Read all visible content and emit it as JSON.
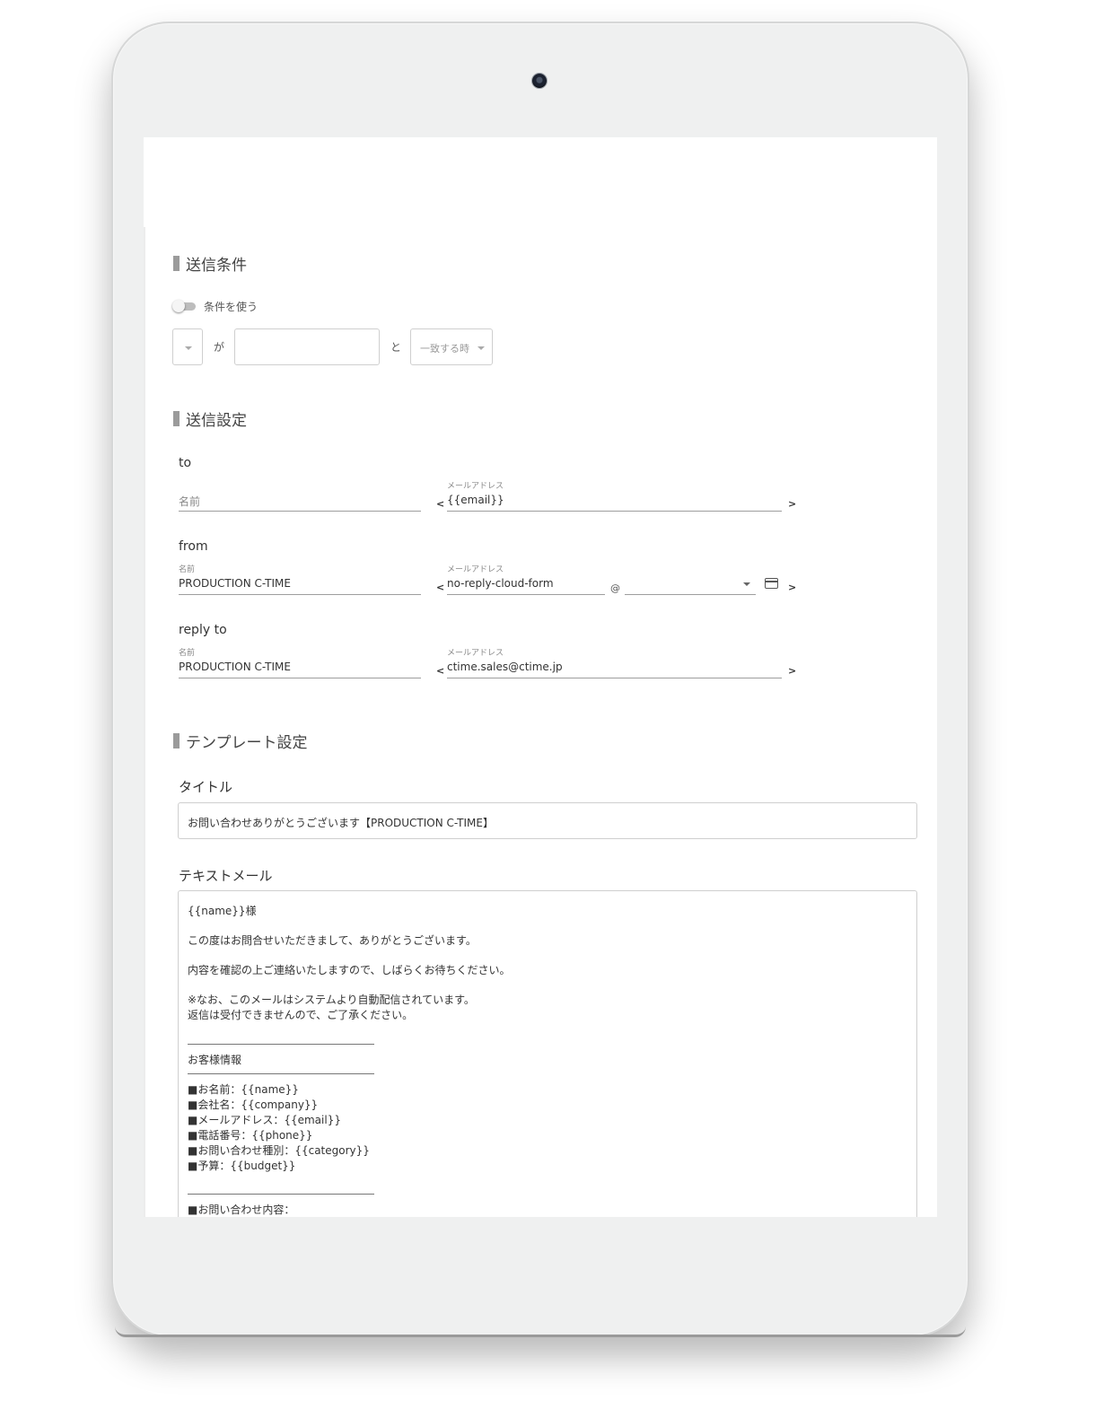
{
  "send_conditions": {
    "title": "送信条件",
    "toggle_label": "条件を使う",
    "field_select_value": "",
    "ga_label": "が",
    "value_input": "",
    "to_label": "と",
    "match_select_value": "一致する時"
  },
  "send_settings": {
    "title": "送信設定",
    "to": {
      "label": "to",
      "name_placeholder": "名前",
      "email_label": "メールアドレス",
      "email_value": "{{email}}"
    },
    "from": {
      "label": "from",
      "name_label": "名前",
      "name_value": "PRODUCTION C-TIME",
      "email_label": "メールアドレス",
      "email_local": "no-reply-cloud-form",
      "at_sign": "@",
      "domain_value": ""
    },
    "reply_to": {
      "label": "reply to",
      "name_label": "名前",
      "name_value": "PRODUCTION C-TIME",
      "email_label": "メールアドレス",
      "email_value": "ctime.sales@ctime.jp"
    },
    "open_angle": "<",
    "close_angle": ">"
  },
  "template_settings": {
    "title": "テンプレート設定",
    "subject_label": "タイトル",
    "subject_value": "お問い合わせありがとうございます【PRODUCTION C-TIME】",
    "text_mail_label": "テキストメール",
    "text_mail_lines": [
      "{{name}}様",
      "この度はお問合せいただきまして、ありがとうございます。",
      "内容を確認の上ご連絡いたしますので、しばらくお待ちください。",
      "※なお、このメールはシステムより自動配信されています。",
      "返信は受付できませんので、ご了承ください。",
      "お客様情報",
      "■お名前：{{name}}",
      "■会社名：{{company}}",
      "■メールアドレス：{{email}}",
      "■電話番号：{{phone}}",
      "■お問い合わせ種別：{{category}}",
      "■予算：{{budget}}",
      "■お問い合わせ内容："
    ]
  },
  "icons": {
    "calendar": "credit-card-icon",
    "camera": "camera-icon"
  }
}
